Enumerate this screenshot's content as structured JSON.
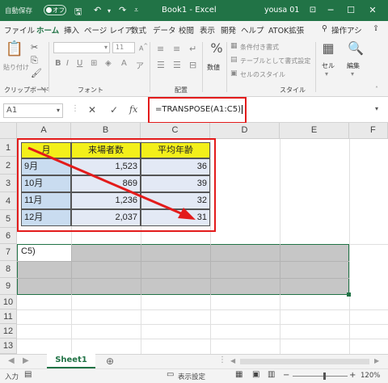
{
  "titlebar": {
    "autosave_label": "自動保存",
    "autosave_state": "オフ",
    "title": "Book1  -  Excel",
    "user": "yousa 01"
  },
  "tabs": [
    "ファイル",
    "ホーム",
    "挿入",
    "ページ レイア",
    "数式",
    "データ",
    "校閲",
    "表示",
    "開発",
    "ヘルプ",
    "ATOK拡張",
    "操作アシ"
  ],
  "active_tab": "ホーム",
  "ribbon": {
    "paste_label": "貼り付け",
    "clipboard_group": "クリップボード",
    "font_group": "フォント",
    "font_size": "11",
    "align_group": "配置",
    "number_label": "数値",
    "style_group": "スタイル",
    "cond_format": "条件付き書式",
    "table_format": "テーブルとして書式設定",
    "cell_style": "セルのスタイル",
    "cells_label": "セル",
    "edit_label": "編集"
  },
  "formula_bar": {
    "name_box": "A1",
    "fx": "fx",
    "formula": "=TRANSPOSE(A1:C5)"
  },
  "columns": [
    "A",
    "B",
    "C",
    "D",
    "E",
    "F"
  ],
  "rows": [
    "1",
    "2",
    "3",
    "4",
    "5",
    "6",
    "7",
    "8",
    "9",
    "10",
    "11",
    "12",
    "13"
  ],
  "table": {
    "headers": [
      "月",
      "来場者数",
      "平均年齢"
    ],
    "rows": [
      [
        "9月",
        "1,523",
        "36"
      ],
      [
        "10月",
        "869",
        "39"
      ],
      [
        "11月",
        "1,236",
        "32"
      ],
      [
        "12月",
        "2,037",
        "31"
      ]
    ]
  },
  "edit_cell_text": "C5)",
  "sheet_tab": "Sheet1",
  "status": {
    "mode": "入力",
    "display_settings": "表示設定",
    "zoom": "120%"
  },
  "colors": {
    "excel_green": "#217346",
    "highlight_red": "#e31b1b",
    "header_fill": "#f3ef1a",
    "data_fill": "#e3e9f5",
    "a_col_fill": "#c9dcf0",
    "transpose_fill": "#c6c6c6"
  }
}
